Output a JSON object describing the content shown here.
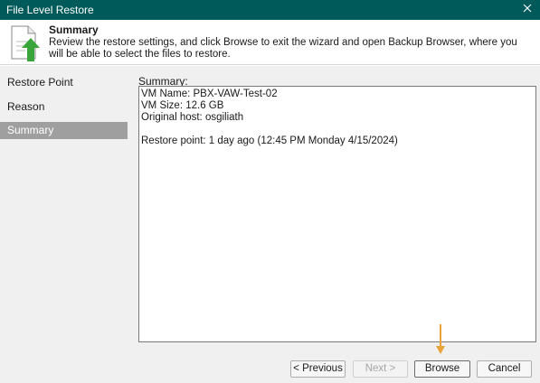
{
  "window": {
    "title": "File Level Restore"
  },
  "header": {
    "title": "Summary",
    "description": "Review the restore settings, and click Browse to exit the wizard and open Backup Browser, where you will be able to select the files to restore."
  },
  "sidebar": {
    "items": [
      {
        "label": "Restore Point"
      },
      {
        "label": "Reason"
      },
      {
        "label": "Summary"
      }
    ]
  },
  "summary": {
    "label": "Summary:",
    "lines": [
      "VM Name: PBX-VAW-Test-02",
      "VM Size: 12.6 GB",
      "Original host: osgiliath",
      "",
      "Restore point: 1 day ago (12:45 PM Monday 4/15/2024)"
    ]
  },
  "buttons": {
    "previous": "< Previous",
    "next": "Next >",
    "browse": "Browse",
    "cancel": "Cancel"
  },
  "colors": {
    "titlebar": "#005a5a",
    "accent_arrow": "#e8a33a",
    "icon_green": "#3aa53a",
    "active_nav": "#9f9f9f"
  },
  "icons": [
    "close-icon",
    "restore-wizard-icon",
    "down-arrow-annotation-icon"
  ]
}
